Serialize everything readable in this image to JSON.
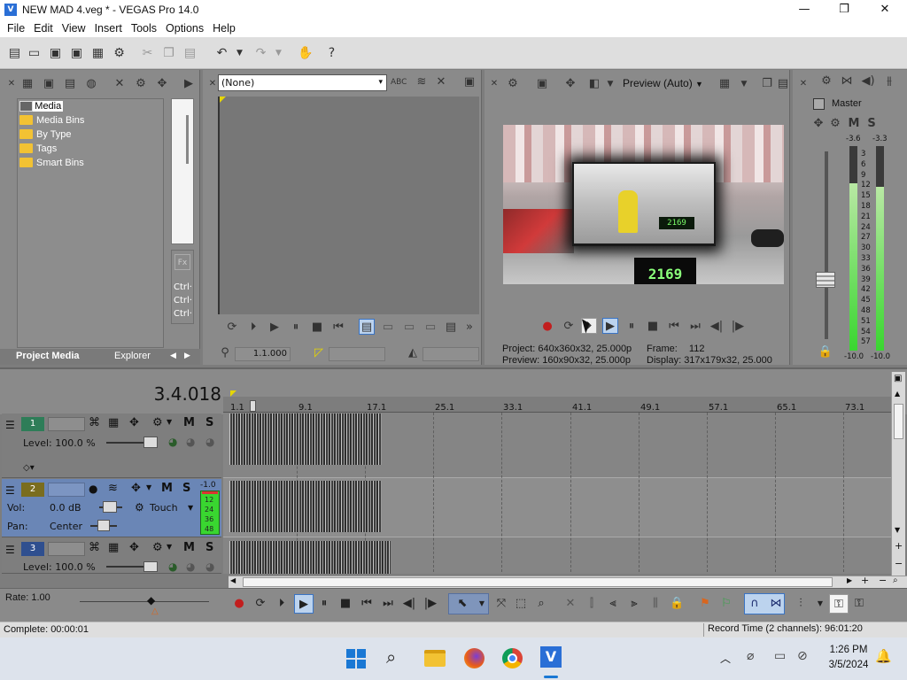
{
  "window": {
    "title": "NEW MAD 4.veg * - VEGAS Pro 14.0",
    "app_icon": "V"
  },
  "menu": [
    "File",
    "Edit",
    "View",
    "Insert",
    "Tools",
    "Options",
    "Help"
  ],
  "project_media": {
    "tree": [
      "All Media",
      "Media Bins",
      "By Type",
      "Tags",
      "Smart Bins"
    ],
    "expander": "+",
    "tabs": [
      "Project Media",
      "Explorer"
    ],
    "ctrl_labels": [
      "Ctrl·",
      "Ctrl·",
      "Ctrl·"
    ]
  },
  "trimmer": {
    "dropdown_value": "(None)",
    "timecode": "1.1.000"
  },
  "preview": {
    "quality": "Preview (Auto)",
    "overlay_counter": "2169",
    "overlay_counter_small": "2169",
    "project_label": "Project:",
    "project_value": "640x360x32, 25.000p",
    "frame_label": "Frame:",
    "frame_value": "112",
    "preview_label": "Preview:",
    "preview_value": "160x90x32, 25.000p",
    "display_label": "Display:",
    "display_value": "317x179x32, 25.000"
  },
  "master": {
    "label": "Master",
    "m": "M",
    "s": "S",
    "peak_left": "-3.6",
    "peak_right": "-3.3",
    "scale": [
      "3",
      "6",
      "9",
      "12",
      "15",
      "18",
      "21",
      "24",
      "27",
      "30",
      "33",
      "36",
      "39",
      "42",
      "45",
      "48",
      "51",
      "54",
      "57"
    ],
    "bottom_left": "-10.0",
    "bottom_right": "-10.0",
    "level_left": 0.82,
    "level_right": 0.8
  },
  "timeline": {
    "cursor_time": "3.4.018",
    "ruler": [
      "1.1",
      "9.1",
      "17.1",
      "25.1",
      "33.1",
      "41.1",
      "49.1",
      "57.1",
      "65.1",
      "73.1"
    ]
  },
  "tracks": [
    {
      "num": "1",
      "m": "M",
      "s": "S",
      "level_label": "Level: 100.0 %"
    },
    {
      "num": "2",
      "m": "M",
      "s": "S",
      "vol_label": "Vol:",
      "vol_value": "0.0 dB",
      "pan_label": "Pan:",
      "pan_value": "Center",
      "mode": "Touch",
      "meter_top": "-1.0",
      "meter_scale": [
        "12",
        "24",
        "36",
        "48"
      ]
    },
    {
      "num": "3",
      "m": "M",
      "s": "S",
      "level_label": "Level: 100.0 %"
    }
  ],
  "rate": "Rate: 1.00",
  "status": {
    "left": "Complete: 00:00:01",
    "right": "Record Time (2 channels): 96:01:20"
  },
  "taskbar": {
    "time": "1:26 PM",
    "date": "3/5/2024"
  },
  "colors": {
    "accent": "#6a86b6",
    "meter_green": "#39d630",
    "selected_track": "#6a86b6"
  }
}
